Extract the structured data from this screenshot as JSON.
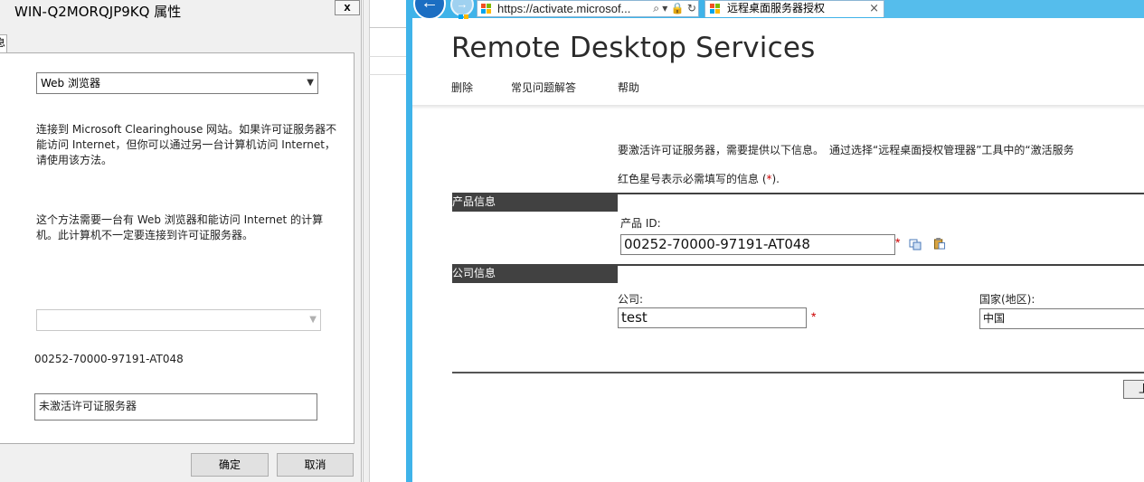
{
  "dialog": {
    "title": "WIN-Q2MORQJP9KQ 属性",
    "close_label": "x",
    "tab_label": "息",
    "connection_method": "Web 浏览器",
    "desc1": "连接到 Microsoft Clearinghouse 网站。如果许可证服务器不能访问 Internet，但你可以通过另一台计算机访问 Internet，请使用该方法。",
    "desc2": "这个方法需要一台有 Web 浏览器和能访问 Internet 的计算机。此计算机不一定要连接到许可证服务器。",
    "product_id": "00252-70000-97191-AT048",
    "status": "未激活许可证服务器",
    "ok_label": "确定",
    "cancel_label": "取消"
  },
  "browser": {
    "back_label": "←",
    "forward_label": "→",
    "url": "https://activate.microsof...",
    "url_controls": "⌕ ▾ 🔒 ↻",
    "tab_title": "远程桌面服务器授权",
    "tab_close": "×",
    "logo_colors": [
      "#f25022",
      "#7fba00",
      "#00a4ef",
      "#ffb900"
    ]
  },
  "page": {
    "title": "Remote Desktop Services",
    "nav": [
      "删除",
      "常见问题解答",
      "帮助"
    ],
    "intro": "要激活许可证服务器，需要提供以下信息。　通过选择“远程桌面授权管理器”工具中的“激活服务",
    "required_prefix": "红色星号表示必需填写的信息 (",
    "required_star": "*",
    "required_suffix": ").",
    "product_section": "产品信息",
    "product_id_label": "产品 ID:",
    "product_id_value": "00252-70000-97191-AT048",
    "company_section": "公司信息",
    "company_label": "公司:",
    "company_value": "test",
    "country_label": "国家(地区):",
    "country_value": "中国",
    "next_label": "上"
  }
}
